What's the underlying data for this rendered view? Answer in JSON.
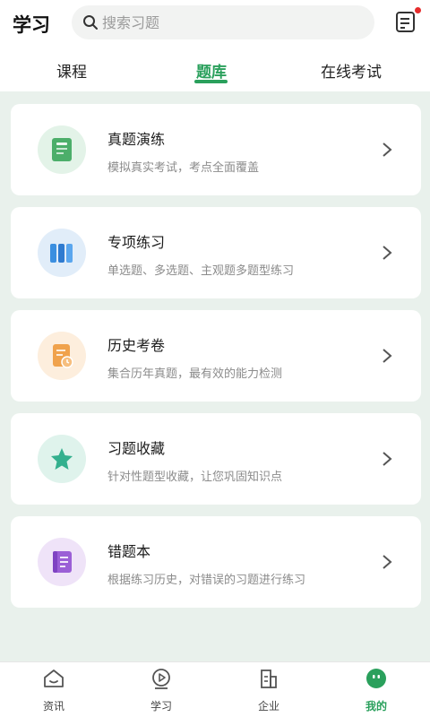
{
  "header": {
    "title": "学习",
    "search_placeholder": "搜索习题",
    "note_icon": "note-icon",
    "notification_color": "#e62c2c"
  },
  "tabs": [
    {
      "label": "课程",
      "active": false
    },
    {
      "label": "题库",
      "active": true
    },
    {
      "label": "在线考试",
      "active": false
    }
  ],
  "accent_color": "#2aa05c",
  "cards": [
    {
      "title": "真题演练",
      "desc": "模拟真实考试，考点全面覆盖",
      "icon": "book-icon",
      "color": "#4cae6a"
    },
    {
      "title": "专项练习",
      "desc": "单选题、多选题、主观题多题型练习",
      "icon": "books-icon",
      "color": "#3b8fe0"
    },
    {
      "title": "历史考卷",
      "desc": "集合历年真题，最有效的能力检测",
      "icon": "exam-paper-icon",
      "color": "#f0a24c"
    },
    {
      "title": "习题收藏",
      "desc": "针对性题型收藏，让您巩固知识点",
      "icon": "star-icon",
      "color": "#33b08e"
    },
    {
      "title": "错题本",
      "desc": "根据练习历史，对错误的习题进行练习",
      "icon": "notebook-icon",
      "color": "#9b5fd6"
    }
  ],
  "bottom_nav": [
    {
      "label": "资讯",
      "icon": "home-icon",
      "active": false
    },
    {
      "label": "学习",
      "icon": "play-icon",
      "active": false
    },
    {
      "label": "企业",
      "icon": "building-icon",
      "active": false
    },
    {
      "label": "我的",
      "icon": "profile-icon",
      "active": true
    }
  ]
}
